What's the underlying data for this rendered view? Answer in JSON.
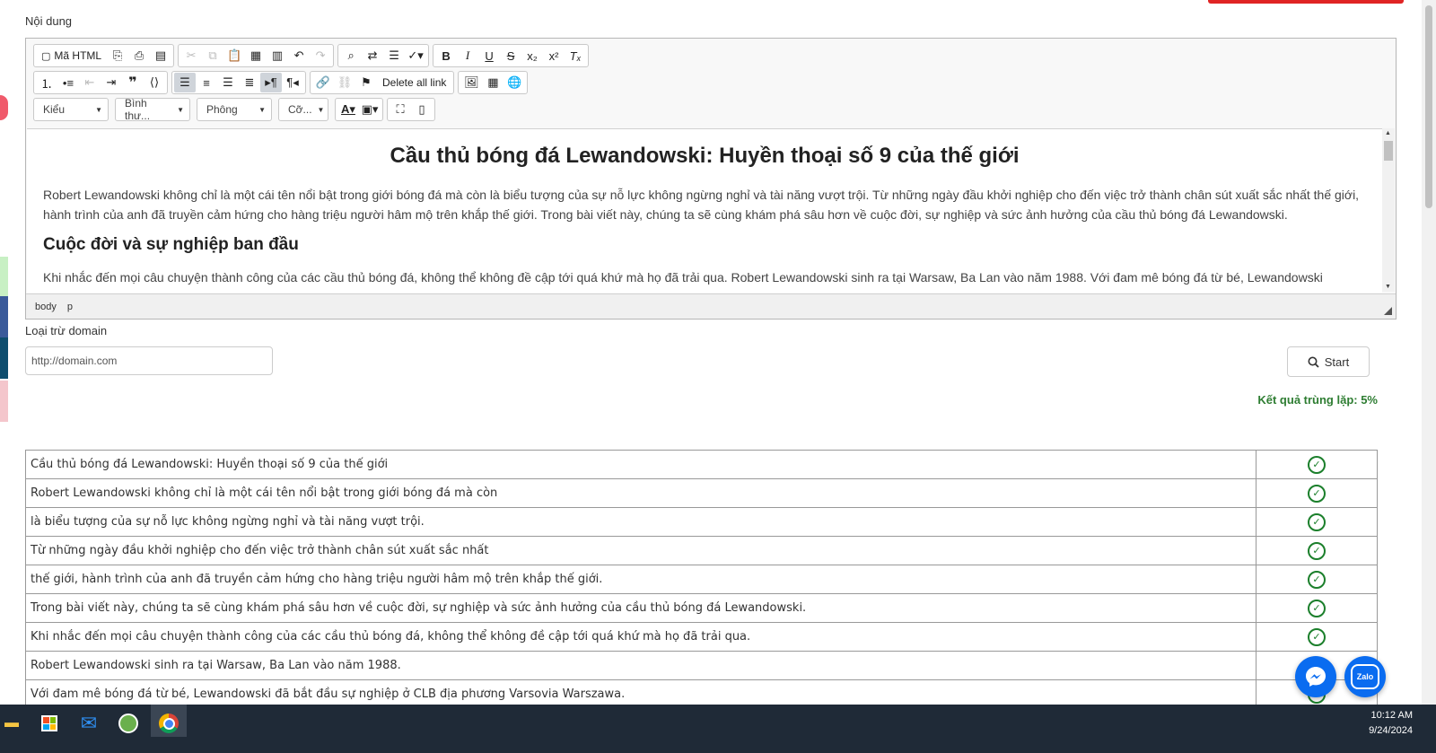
{
  "labels": {
    "content": "Nội dung",
    "exclude_domain": "Loại trừ domain"
  },
  "toolbar": {
    "source_label": "Mã HTML",
    "delete_all_link": "Delete all link",
    "style_combo": "Kiểu",
    "format_combo": "Bình thư...",
    "font_combo": "Phông",
    "size_combo": "Cỡ..."
  },
  "editor": {
    "title": "Cầu thủ bóng đá Lewandowski: Huyền thoại số 9 của thế giới",
    "intro": "Robert Lewandowski không chỉ là một cái tên nổi bật trong giới bóng đá mà còn là biểu tượng của sự nỗ lực không ngừng nghỉ và tài năng vượt trội. Từ những ngày đầu khởi nghiệp cho đến việc trở thành chân sút xuất sắc nhất thế giới, hành trình của anh đã truyền cảm hứng cho hàng triệu người hâm mộ trên khắp thế giới. Trong bài viết này, chúng ta sẽ cùng khám phá sâu hơn về cuộc đời, sự nghiệp và sức ảnh hưởng của cầu thủ bóng đá Lewandowski.",
    "heading": "Cuộc đời và sự nghiệp ban đầu",
    "para2": "Khi nhắc đến mọi câu chuyện thành công của các cầu thủ bóng đá, không thể không đề cập tới quá khứ mà họ đã trải qua. Robert Lewandowski sinh ra tại Warsaw, Ba Lan vào năm 1988. Với đam mê bóng đá từ bé, Lewandowski",
    "path": [
      "body",
      "p"
    ]
  },
  "domain_input": {
    "placeholder": "http://domain.com",
    "value": ""
  },
  "start_button": "Start",
  "result_label": "Kết quả trùng lặp: 5%",
  "rows": [
    {
      "text": "Cầu thủ bóng đá Lewandowski: Huyền thoại số 9 của thế giới",
      "status": "ok"
    },
    {
      "text": "Robert Lewandowski không chỉ là một cái tên nổi bật trong giới bóng đá mà còn",
      "status": "ok"
    },
    {
      "text": "là biểu tượng của sự nỗ lực không ngừng nghỉ và tài năng vượt trội.",
      "status": "ok"
    },
    {
      "text": "Từ những ngày đầu khởi nghiệp cho đến việc trở thành chân sút xuất sắc nhất",
      "status": "ok"
    },
    {
      "text": "thế giới, hành trình của anh đã truyền cảm hứng cho hàng triệu người hâm mộ trên khắp thế giới.",
      "status": "ok"
    },
    {
      "text": "Trong bài viết này, chúng ta sẽ cùng khám phá sâu hơn về cuộc đời, sự nghiệp và sức ảnh hưởng của cầu thủ bóng đá Lewandowski.",
      "status": "ok"
    },
    {
      "text": "Khi nhắc đến mọi câu chuyện thành công của các cầu thủ bóng đá, không thể không đề cập tới quá khứ mà họ đã trải qua.",
      "status": "ok"
    },
    {
      "text": "Robert Lewandowski sinh ra tại Warsaw, Ba Lan vào năm 1988.",
      "status": "error"
    },
    {
      "text": "Với đam mê bóng đá từ bé, Lewandowski đã bắt đầu sự nghiệp ở CLB địa phương Varsovia Warszawa.",
      "status": "ok"
    }
  ],
  "status_icons": {
    "ok": "✓",
    "error": "!"
  },
  "colors": {
    "ok": "#1b7f2b",
    "error": "#ee0000",
    "result": "#2e7d32",
    "messenger": "#0a6cf0",
    "zalo": "#0a6cf0"
  },
  "taskbar": {
    "time": "10:12 AM",
    "date": "9/24/2024"
  }
}
